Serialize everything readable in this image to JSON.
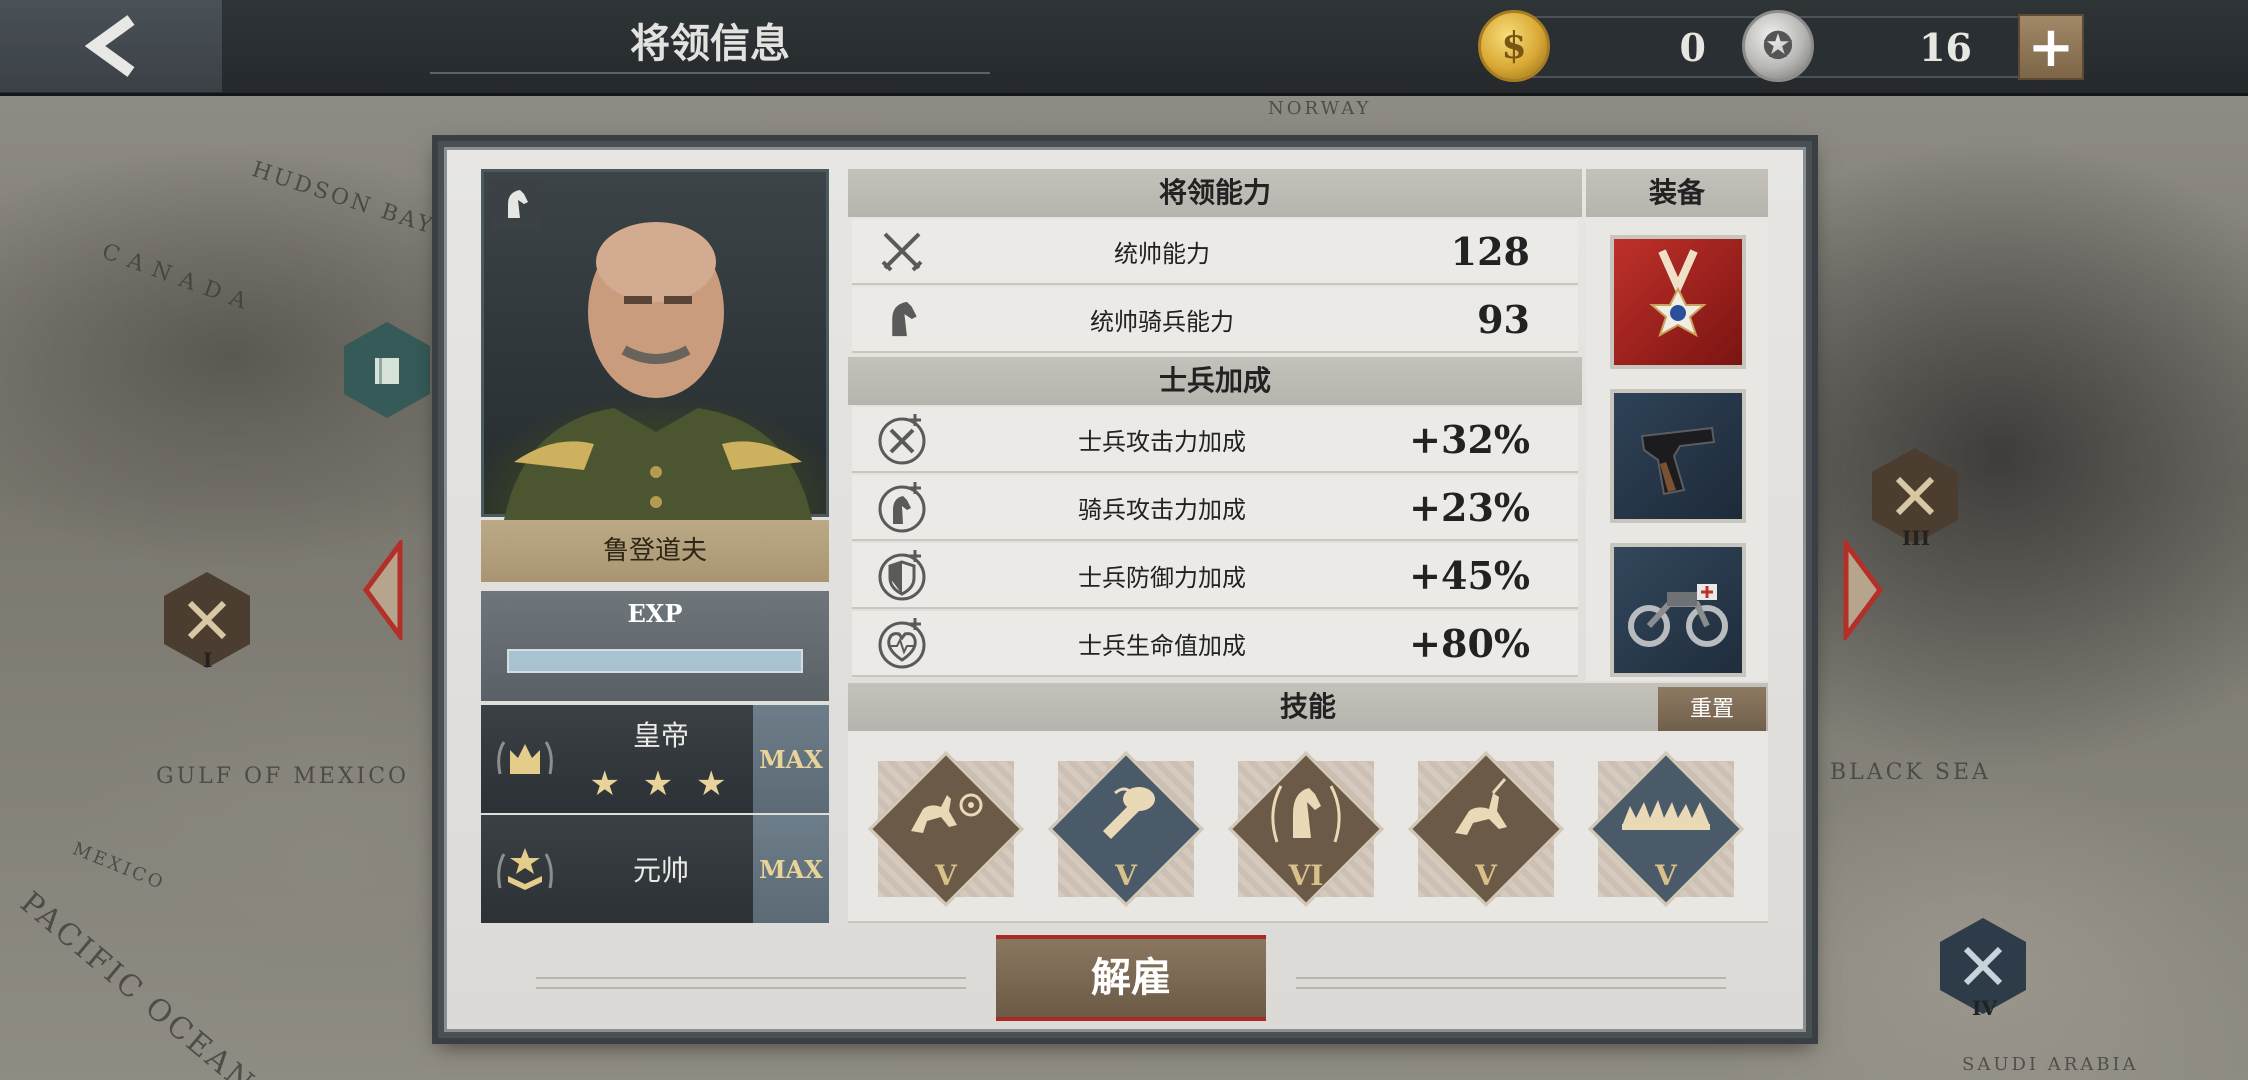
{
  "topbar": {
    "title": "将领信息",
    "back_icon": "chevron-left-icon",
    "gold": "0",
    "medals": "16",
    "plus_label": "+"
  },
  "map": {
    "labels": [
      "HUDSON BAY",
      "CANADA",
      "GULF OF MEXICO",
      "MEXICO",
      "PACIFIC OCEAN",
      "NORWAY",
      "BLACK SEA",
      "SAUDI ARABIA"
    ],
    "markers": [
      "I",
      "III",
      "IV"
    ]
  },
  "general": {
    "name": "鲁登道夫",
    "class_icon": "horse-head-icon",
    "exp_label": "EXP",
    "exp_progress": 1.0,
    "ranks": [
      {
        "name": "皇帝",
        "stars": "★ ★ ★",
        "max_label": "MAX",
        "icon": "crown-icon"
      },
      {
        "name": "元帅",
        "max_label": "MAX",
        "icon": "marshal-insignia-icon"
      }
    ]
  },
  "abilities": {
    "header": "将领能力",
    "rows": [
      {
        "name": "统帅能力",
        "value": "128",
        "icon": "crossed-swords-icon"
      },
      {
        "name": "统帅骑兵能力",
        "value": "93",
        "icon": "horse-head-icon"
      }
    ]
  },
  "bonuses": {
    "header": "士兵加成",
    "rows": [
      {
        "name": "士兵攻击力加成",
        "value": "+32%",
        "icon": "attack-plus-icon"
      },
      {
        "name": "骑兵攻击力加成",
        "value": "+23%",
        "icon": "cavalry-plus-icon"
      },
      {
        "name": "士兵防御力加成",
        "value": "+45%",
        "icon": "shield-plus-icon"
      },
      {
        "name": "士兵生命值加成",
        "value": "+80%",
        "icon": "heart-plus-icon"
      }
    ]
  },
  "equipment": {
    "header": "装备",
    "items": [
      "medal-icon",
      "pistol-icon",
      "motorcycle-icon"
    ]
  },
  "skills": {
    "header": "技能",
    "reset_label": "重置",
    "items": [
      {
        "level": "V",
        "icon": "cavalry-target-icon",
        "color": "#6b5a47"
      },
      {
        "level": "V",
        "icon": "bugle-icon",
        "color": "#4a5a68"
      },
      {
        "level": "VI",
        "icon": "horse-laurel-icon",
        "color": "#6b5a47"
      },
      {
        "level": "V",
        "icon": "cavalry-charge-icon",
        "color": "#6b5a47"
      },
      {
        "level": "V",
        "icon": "fire-barrage-icon",
        "color": "#4a5a68"
      }
    ]
  },
  "actions": {
    "dismiss_label": "解雇"
  },
  "colors": {
    "accent_red": "#a62a25",
    "gold_text": "#e8d398",
    "panel_bg": "#e7e6e3"
  }
}
